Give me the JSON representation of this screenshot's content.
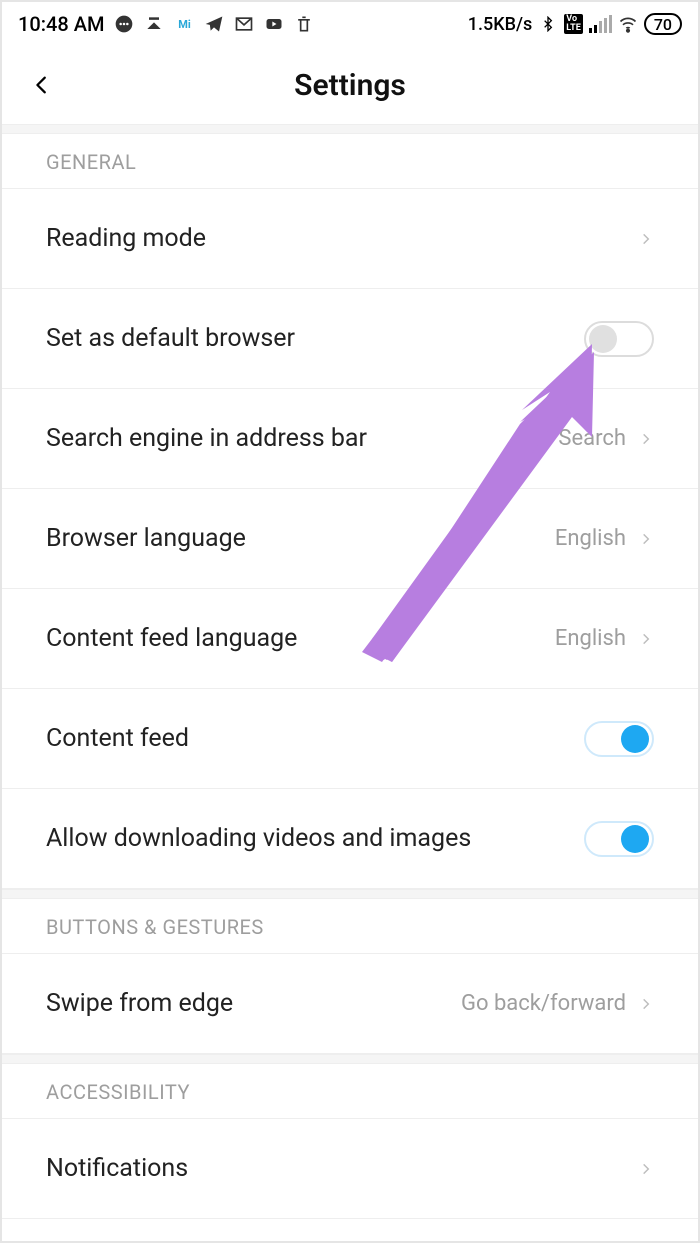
{
  "statusbar": {
    "time": "10:48 AM",
    "data_rate": "1.5KB/s",
    "battery": "70"
  },
  "header": {
    "title": "Settings"
  },
  "sections": {
    "general": {
      "header": "GENERAL",
      "reading_mode": "Reading mode",
      "default_browser": "Set as default browser",
      "search_engine_label": "Search engine in address bar",
      "search_engine_value": "Search",
      "browser_language_label": "Browser language",
      "browser_language_value": "English",
      "content_feed_language_label": "Content feed language",
      "content_feed_language_value": "English",
      "content_feed_label": "Content feed",
      "allow_download_label": "Allow downloading videos and images"
    },
    "buttons_gestures": {
      "header": "BUTTONS & GESTURES",
      "swipe_edge_label": "Swipe from edge",
      "swipe_edge_value": "Go back/forward"
    },
    "accessibility": {
      "header": "ACCESSIBILITY",
      "notifications": "Notifications"
    }
  },
  "toggles": {
    "default_browser": false,
    "content_feed": true,
    "allow_download": true
  }
}
